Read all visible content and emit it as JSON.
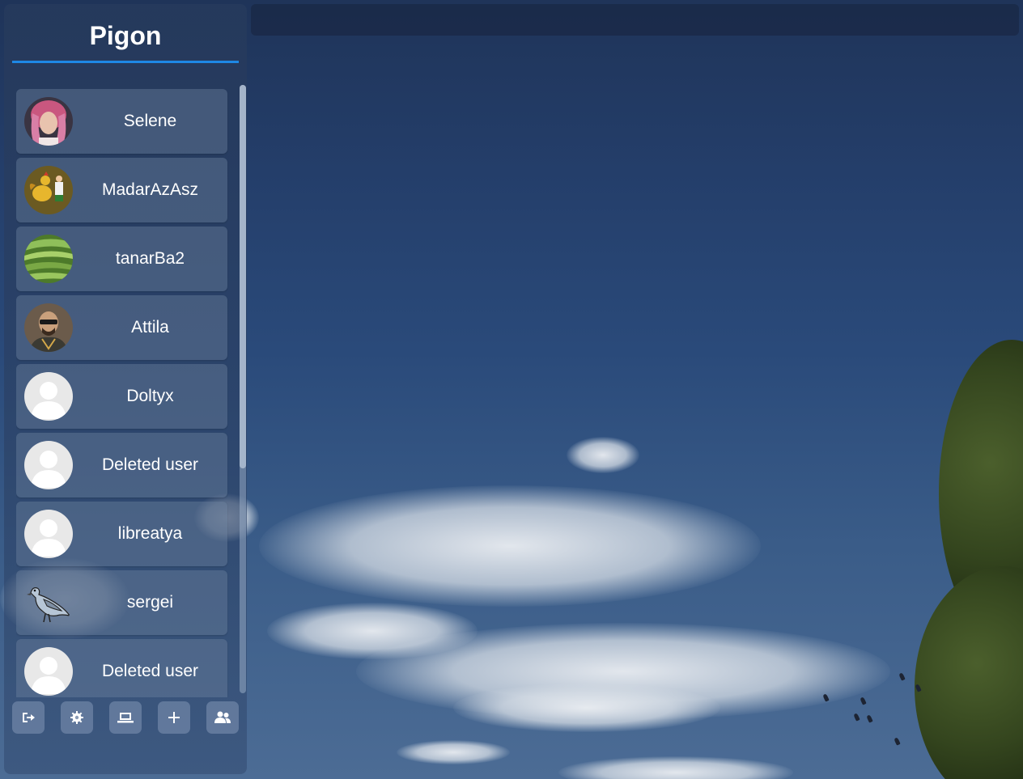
{
  "app": {
    "title": "Pigon",
    "accent_color": "#1e88e5"
  },
  "chats": [
    {
      "name": "Selene",
      "avatar": "photo-woman-pink-hair"
    },
    {
      "name": "MadarAzAsz",
      "avatar": "cartoon-rooster"
    },
    {
      "name": "tanarBa2",
      "avatar": "photo-rice-terraces"
    },
    {
      "name": "Attila",
      "avatar": "photo-man-sunglasses"
    },
    {
      "name": "Doltyx",
      "avatar": "default-user-icon"
    },
    {
      "name": "Deleted user",
      "avatar": "default-user-icon"
    },
    {
      "name": "libreatya",
      "avatar": "default-user-icon"
    },
    {
      "name": "sergei",
      "avatar": "pigeon-drawing"
    },
    {
      "name": "Deleted user",
      "avatar": "default-user-icon"
    }
  ],
  "toolbar": [
    {
      "icon": "logout-icon"
    },
    {
      "icon": "gear-icon"
    },
    {
      "icon": "laptop-icon"
    },
    {
      "icon": "plus-icon"
    },
    {
      "icon": "users-icon"
    }
  ],
  "scroll": {
    "position_fraction": 0.0,
    "visible_fraction": 0.63
  }
}
